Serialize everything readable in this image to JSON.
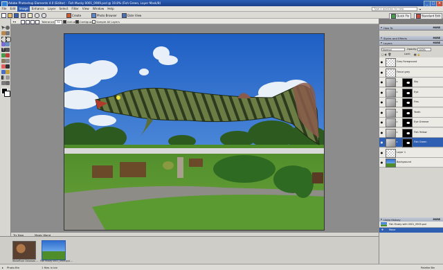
{
  "window": {
    "title": "Adobe Photoshop Elements 4.0 (Editor) - Fish Musky 0001_0909.psd @ 19.8% (Fish Green, Layer Mask/8)",
    "controls": [
      "_",
      "□",
      "×"
    ]
  },
  "menu": {
    "items": [
      "File",
      "Edit",
      "Image",
      "Enhance",
      "Layer",
      "Select",
      "Filter",
      "View",
      "Window",
      "Help"
    ],
    "active_index": 2,
    "help_placeholder": "Type a question for help"
  },
  "shortcuts": {
    "create_label": "Create",
    "photo_browser_label": "Photo Browser",
    "date_view_label": "Date View",
    "quick_fix_label": "Quick Fix",
    "standard_edit_label": "Standard Edit"
  },
  "options": {
    "tolerance_label": "Tolerance:",
    "tolerance_value": "32",
    "anti_alias_label": "Anti-alias",
    "contiguous_label": "Contiguous",
    "sample_all_label": "Sample All Layers"
  },
  "canvas": {
    "tab_label": "Try Now",
    "tool_hint": "Magic Wand"
  },
  "photo_bin": {
    "items": [
      {
        "caption": "WhiteRiver Arkansas ..."
      },
      {
        "caption": "Fish Musky 0001_0909.psd ..."
      }
    ]
  },
  "status": {
    "left": "Photo Bin",
    "mid": "1 files in bin",
    "right": "Palette Bin"
  },
  "palettes": {
    "how_to_title": "How To",
    "styles_title": "Styles and Effects",
    "layers_title": "Layers",
    "more_label": "MORE",
    "blend_mode": "Normal",
    "opacity_label": "Opacity:",
    "opacity_value": "100%",
    "lock_label": "Lock:",
    "undo_title": "Undo History",
    "undo_items": [
      "Fish Musky with 0001_0909.psd",
      "Move"
    ]
  },
  "layers": [
    {
      "name": "Grey Foreground",
      "thumb": "checker",
      "mask": false,
      "selected": false
    },
    {
      "name": "Fence grey",
      "thumb": "checker",
      "mask": false,
      "selected": false
    },
    {
      "name": "Sky",
      "thumb": "fish",
      "mask": true,
      "selected": false
    },
    {
      "name": "Eye",
      "thumb": "fish",
      "mask": true,
      "selected": false
    },
    {
      "name": "Fins",
      "thumb": "fish",
      "mask": true,
      "selected": false
    },
    {
      "name": "Teeth",
      "thumb": "fish",
      "mask": true,
      "selected": false
    },
    {
      "name": "Eye Greener",
      "thumb": "fish",
      "mask": true,
      "selected": false
    },
    {
      "name": "Fish Yellow",
      "thumb": "fish",
      "mask": true,
      "selected": false
    },
    {
      "name": "Fish Green",
      "thumb": "fish",
      "mask": true,
      "selected": true
    },
    {
      "name": "Layer 1",
      "thumb": "checker",
      "mask": false,
      "selected": false
    },
    {
      "name": "Background",
      "thumb": "photo",
      "mask": false,
      "selected": false
    }
  ],
  "colors": {
    "title_bar": "#1b3f8a",
    "selection": "#2f5fb3",
    "sky": "#2f6fd0",
    "grass": "#4f8c2a",
    "fish": "#5b6d3a"
  }
}
